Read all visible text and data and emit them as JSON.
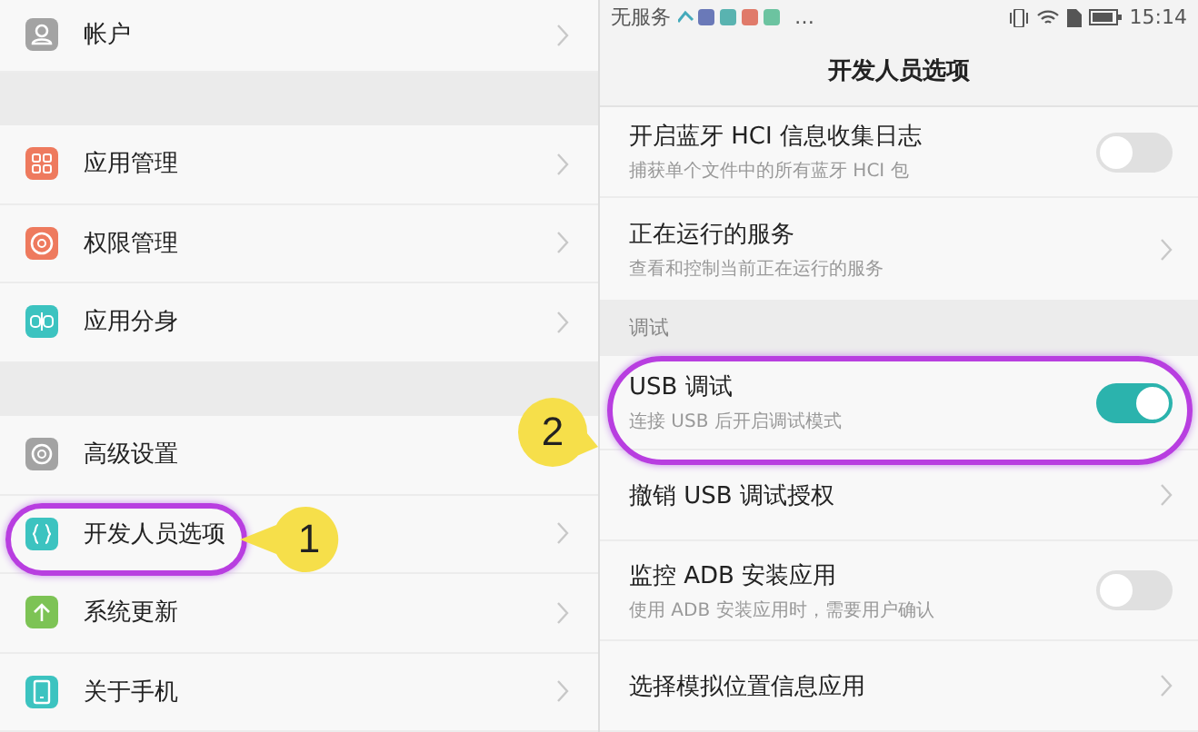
{
  "settings": {
    "groups": [
      {
        "items": [
          {
            "label": "帐户",
            "color": "#a3a3a3"
          }
        ]
      },
      {
        "items": [
          {
            "label": "应用管理",
            "color": "#ee7a5e"
          },
          {
            "label": "权限管理",
            "color": "#ee7a5e"
          },
          {
            "label": "应用分身",
            "color": "#3cc3c0"
          }
        ]
      },
      {
        "items": [
          {
            "label": "高级设置",
            "color": "#a3a3a3"
          },
          {
            "label": "开发人员选项",
            "color": "#3cc3c0"
          },
          {
            "label": "系统更新",
            "color": "#7dc355"
          },
          {
            "label": "关于手机",
            "color": "#3cc3c0"
          }
        ]
      }
    ]
  },
  "developer_options": {
    "status_bar": {
      "carrier": "无服务",
      "more": "…",
      "time": "15:14"
    },
    "title": "开发人员选项",
    "rows": [
      {
        "kind": "toggle",
        "title": "开启蓝牙 HCI 信息收集日志",
        "subtitle": "捕获单个文件中的所有蓝牙 HCI 包",
        "on": false
      },
      {
        "kind": "link",
        "title": "正在运行的服务",
        "subtitle": "查看和控制当前正在运行的服务"
      },
      {
        "kind": "header",
        "title": "调试"
      },
      {
        "kind": "toggle",
        "title": "USB 调试",
        "subtitle": "连接 USB 后开启调试模式",
        "on": true
      },
      {
        "kind": "link",
        "title": "撤销 USB 调试授权"
      },
      {
        "kind": "toggle",
        "title": "监控 ADB 安装应用",
        "subtitle": "使用 ADB 安装应用时，需要用户确认",
        "on": false
      },
      {
        "kind": "link",
        "title": "选择模拟位置信息应用"
      }
    ]
  },
  "annotations": [
    {
      "number": "1"
    },
    {
      "number": "2"
    }
  ]
}
